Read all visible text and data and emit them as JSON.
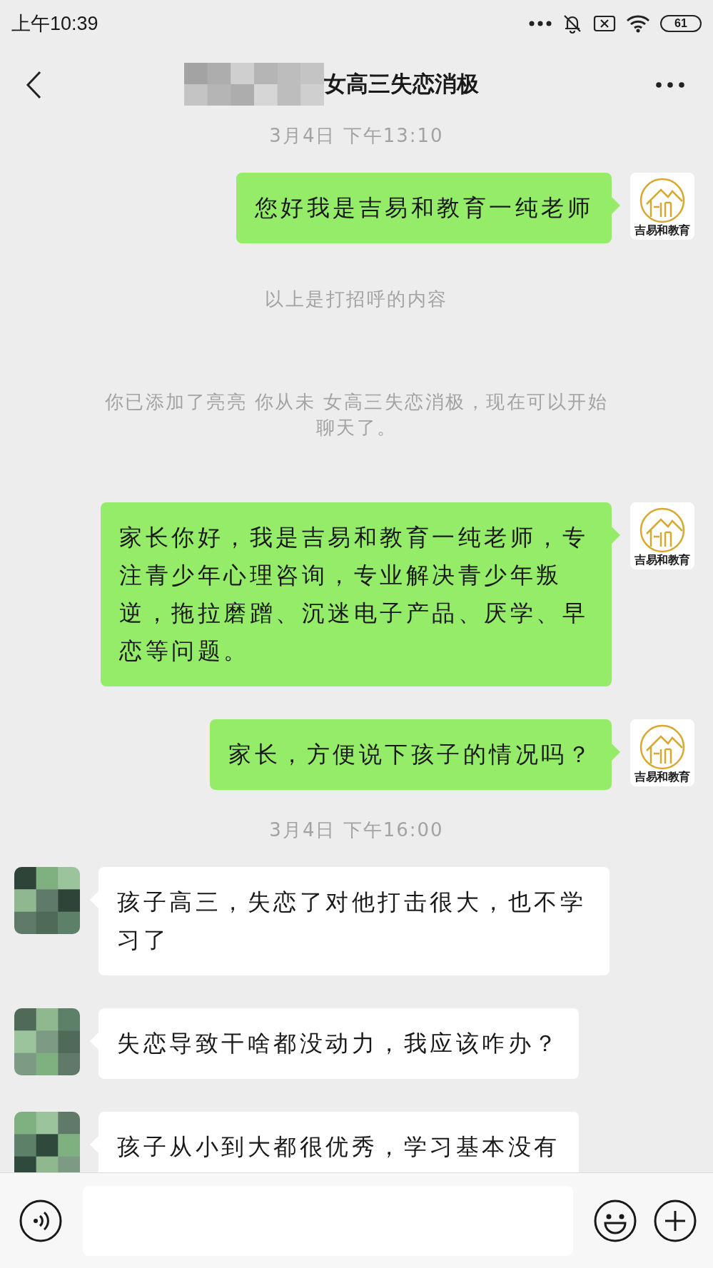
{
  "status_bar": {
    "time": "上午10:39",
    "battery": "61"
  },
  "header": {
    "title": "女高三失恋消极"
  },
  "messages": [
    {
      "kind": "time",
      "text": "3月4日  下午13:10"
    },
    {
      "kind": "outgoing",
      "text": "您好我是吉易和教育一纯老师",
      "avatar_caption": "吉易和教育"
    },
    {
      "kind": "system",
      "text": "以上是打招呼的内容"
    },
    {
      "kind": "system",
      "text": "你已添加了亮亮 你从未 女高三失恋消极，现在可以开始聊天了。"
    },
    {
      "kind": "outgoing",
      "text": "家长你好，我是吉易和教育一纯老师，专注青少年心理咨询，专业解决青少年叛逆，拖拉磨蹭、沉迷电子产品、厌学、早恋等问题。",
      "avatar_caption": "吉易和教育"
    },
    {
      "kind": "outgoing",
      "text": "家长，方便说下孩子的情况吗？",
      "avatar_caption": "吉易和教育"
    },
    {
      "kind": "time",
      "text": "3月4日  下午16:00"
    },
    {
      "kind": "incoming",
      "text": "孩子高三，失恋了对他打击很大，也不学习了"
    },
    {
      "kind": "incoming",
      "text": "失恋导致干啥都没动力，我应该咋办？"
    },
    {
      "kind": "incoming",
      "text": "孩子从小到大都很优秀，学习基本没有"
    }
  ]
}
